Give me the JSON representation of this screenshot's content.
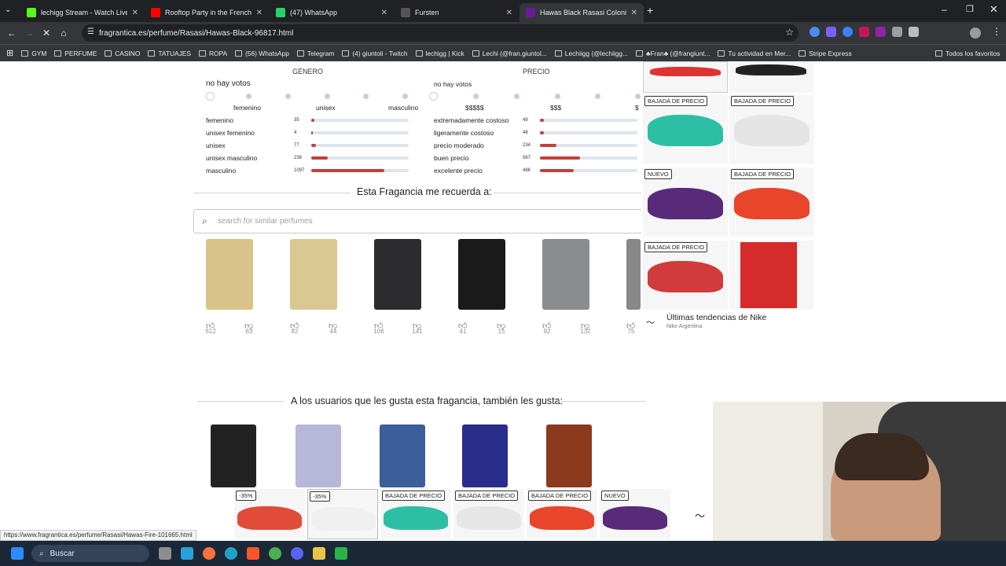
{
  "tabs": [
    {
      "label": "lechigg Stream - Watch Live on",
      "color": "#53fc18"
    },
    {
      "label": "Rooftop Party in the French",
      "color": "#ff0000"
    },
    {
      "label": "(47) WhatsApp",
      "color": "#25d366"
    },
    {
      "label": "Fursten",
      "color": "#555555"
    },
    {
      "label": "Hawas Black Rasasi Colonia - u",
      "color": "#6a1b9a"
    }
  ],
  "address": {
    "url": "fragrantica.es/perfume/Rasasi/Hawas-Black-96817.html"
  },
  "bookmarks": [
    "GYM",
    "PERFUME",
    "CASINO",
    "TATUAJES",
    "ROPA",
    "(56) WhatsApp",
    "Telegram",
    "(4) giuntoli - Twitch",
    "lechigg | Kick",
    "Lechi (@fran.giuntol...",
    "Lechiigg (@lechiigg...",
    "♣Fran♣ (@frangiunt...",
    "Tu actividad en Mer...",
    "Stripe Express",
    "Todos los favoritos"
  ],
  "gender": {
    "header": "GÉNERO",
    "no_votes": "no hay votos",
    "scale": [
      "femenino",
      "unisex",
      "masculino"
    ],
    "rows": [
      {
        "label": "femenino",
        "count": "35",
        "fraction": 0.03
      },
      {
        "label": "unisex femenino",
        "count": "4",
        "fraction": 0.005
      },
      {
        "label": "unisex",
        "count": "77",
        "fraction": 0.05
      },
      {
        "label": "unisex masculino",
        "count": "236",
        "fraction": 0.17
      },
      {
        "label": "masculino",
        "count": "1097",
        "fraction": 0.75
      }
    ]
  },
  "price": {
    "header": "PRECIO",
    "no_votes": "no hay votos",
    "scale": [
      "$$$$$",
      "$$$",
      "$"
    ],
    "rows": [
      {
        "label": "extremadamente costoso",
        "count": "49",
        "fraction": 0.04
      },
      {
        "label": "ligeramente costoso",
        "count": "48",
        "fraction": 0.04
      },
      {
        "label": "precio moderado",
        "count": "234",
        "fraction": 0.17
      },
      {
        "label": "buen precio",
        "count": "567",
        "fraction": 0.41
      },
      {
        "label": "excelente precio",
        "count": "486",
        "fraction": 0.35
      }
    ]
  },
  "reminds": {
    "title": "Esta Fragancia me recuerda a:",
    "search_placeholder": "search for similar perfumes",
    "items": [
      {
        "up": "612",
        "down": "63",
        "color": "#d8c48a"
      },
      {
        "up": "82",
        "down": "44",
        "color": "#d9c890"
      },
      {
        "up": "106",
        "down": "141",
        "color": "#2c2c2e"
      },
      {
        "up": "41",
        "down": "15",
        "color": "#1a1a1a"
      },
      {
        "up": "92",
        "down": "132",
        "color": "#8a8d90"
      },
      {
        "up": "75",
        "down": "",
        "color": "#888888"
      }
    ]
  },
  "also_like": {
    "title": "A los usuarios que les gusta esta fragancia, también les gusta:",
    "items": [
      {
        "color": "#222222"
      },
      {
        "color": "#b7b7d8"
      },
      {
        "color": "#3a5f9a"
      },
      {
        "color": "#2b2d8a"
      },
      {
        "color": "#8b3a1e"
      }
    ]
  },
  "ad": {
    "badges": [
      "BAJADA DE PRECIO",
      "BAJADA DE PRECIO",
      "NUEVO",
      "BAJADA DE PRECIO",
      "BAJADA DE PRECIO"
    ],
    "title": "Últimas tendencias de Nike",
    "subtitle": "Nike Argentina"
  },
  "bottom_ad": {
    "badges": [
      "-35%",
      "-35%",
      "BAJADA DE PRECIO",
      "BAJADA DE PRECIO",
      "BAJADA DE PRECIO",
      "NUEVO"
    ]
  },
  "status_url": "https://www.fragrantica.es/perfume/Rasasi/Hawas-Fire-101665.html",
  "taskbar": {
    "search": "Buscar"
  }
}
